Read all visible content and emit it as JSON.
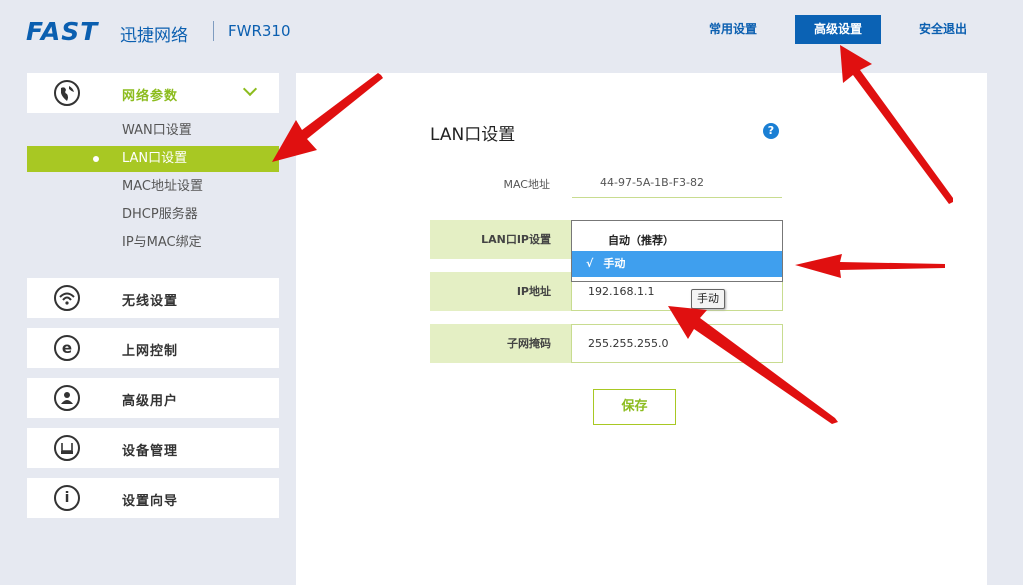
{
  "header": {
    "logo": "FAST",
    "brand": "迅捷网络",
    "model": "FWR310",
    "nav": {
      "common": "常用设置",
      "advanced": "高级设置",
      "logout": "安全退出"
    }
  },
  "sidebar": {
    "network": {
      "label": "网络参数",
      "items": [
        "WAN口设置",
        "LAN口设置",
        "MAC地址设置",
        "DHCP服务器",
        "IP与MAC绑定"
      ]
    },
    "sections": [
      {
        "label": "无线设置",
        "icon": "wifi-icon"
      },
      {
        "label": "上网控制",
        "icon": "e-icon"
      },
      {
        "label": "高级用户",
        "icon": "user-icon"
      },
      {
        "label": "设备管理",
        "icon": "router-icon"
      },
      {
        "label": "设置向导",
        "icon": "info-icon"
      }
    ]
  },
  "main": {
    "title": "LAN口设置",
    "help": "?",
    "mac": {
      "label": "MAC地址",
      "value": "44-97-5A-1B-F3-82"
    },
    "lan_ip_mode": {
      "label": "LAN口IP设置",
      "options": [
        "自动（推荐）",
        "手动"
      ],
      "check": "√"
    },
    "ip": {
      "label": "IP地址",
      "value": "192.168.1.1",
      "tooltip": "手动"
    },
    "mask": {
      "label": "子网掩码",
      "value": "255.255.255.0"
    },
    "save": "保存"
  },
  "colors": {
    "brand_blue": "#0b5fb0",
    "accent_green": "#a8c823",
    "highlight_blue": "#3f9fee",
    "arrow_red": "#e01010"
  }
}
